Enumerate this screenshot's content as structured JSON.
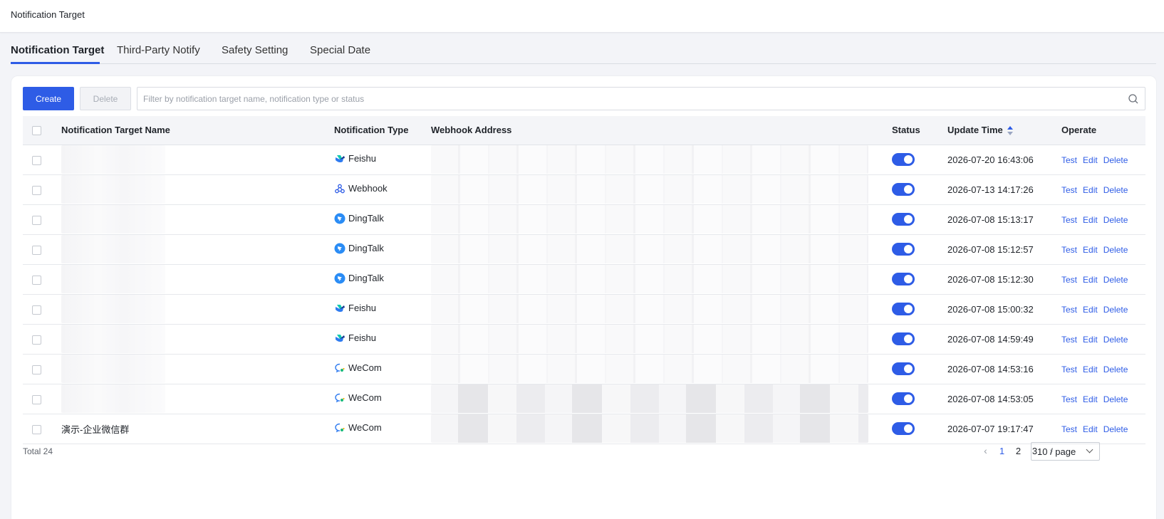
{
  "page": {
    "title": "Notification Target"
  },
  "tabs": [
    {
      "label": "Notification Target",
      "active": true
    },
    {
      "label": "Third-Party Notify"
    },
    {
      "label": "Safety Setting"
    },
    {
      "label": "Special Date"
    }
  ],
  "toolbar": {
    "create_label": "Create",
    "delete_label": "Delete",
    "search_placeholder": "Filter by notification target name, notification type or status"
  },
  "table": {
    "headers": {
      "name": "Notification Target Name",
      "type": "Notification Type",
      "webhook": "Webhook Address",
      "status": "Status",
      "update_time": "Update Time",
      "operate": "Operate"
    },
    "rows": [
      {
        "name": "",
        "type": "Feishu",
        "icon": "feishu-icon",
        "status": "on",
        "time": "2026-07-20 16:43:06"
      },
      {
        "name": "",
        "type": "Webhook",
        "icon": "webhook-icon",
        "status": "on",
        "time": "2026-07-13 14:17:26"
      },
      {
        "name": "",
        "type": "DingTalk",
        "icon": "dingtalk-icon",
        "status": "on",
        "time": "2026-07-08 15:13:17"
      },
      {
        "name": "",
        "type": "DingTalk",
        "icon": "dingtalk-icon",
        "status": "on",
        "time": "2026-07-08 15:12:57"
      },
      {
        "name": "",
        "type": "DingTalk",
        "icon": "dingtalk-icon",
        "status": "on",
        "time": "2026-07-08 15:12:30"
      },
      {
        "name": "",
        "type": "Feishu",
        "icon": "feishu-icon",
        "status": "on",
        "time": "2026-07-08 15:00:32"
      },
      {
        "name": "",
        "type": "Feishu",
        "icon": "feishu-icon",
        "status": "on",
        "time": "2026-07-08 14:59:49"
      },
      {
        "name": "",
        "type": "WeCom",
        "icon": "wecom-icon",
        "status": "on",
        "time": "2026-07-08 14:53:16"
      },
      {
        "name": "",
        "type": "WeCom",
        "icon": "wecom-icon",
        "status": "on",
        "time": "2026-07-08 14:53:05"
      },
      {
        "name": "演示-企业微信群",
        "type": "WeCom",
        "icon": "wecom-icon",
        "status": "on",
        "time": "2026-07-07 19:17:47"
      }
    ],
    "actions": {
      "test": "Test",
      "edit": "Edit",
      "delete": "Delete"
    }
  },
  "footer": {
    "total": "Total 24",
    "pages": [
      "1",
      "2",
      "3"
    ],
    "current_page": "1",
    "prev": "‹",
    "next": "›",
    "page_size": "10 / page"
  },
  "colors": {
    "accent": "#2e5ce6"
  }
}
